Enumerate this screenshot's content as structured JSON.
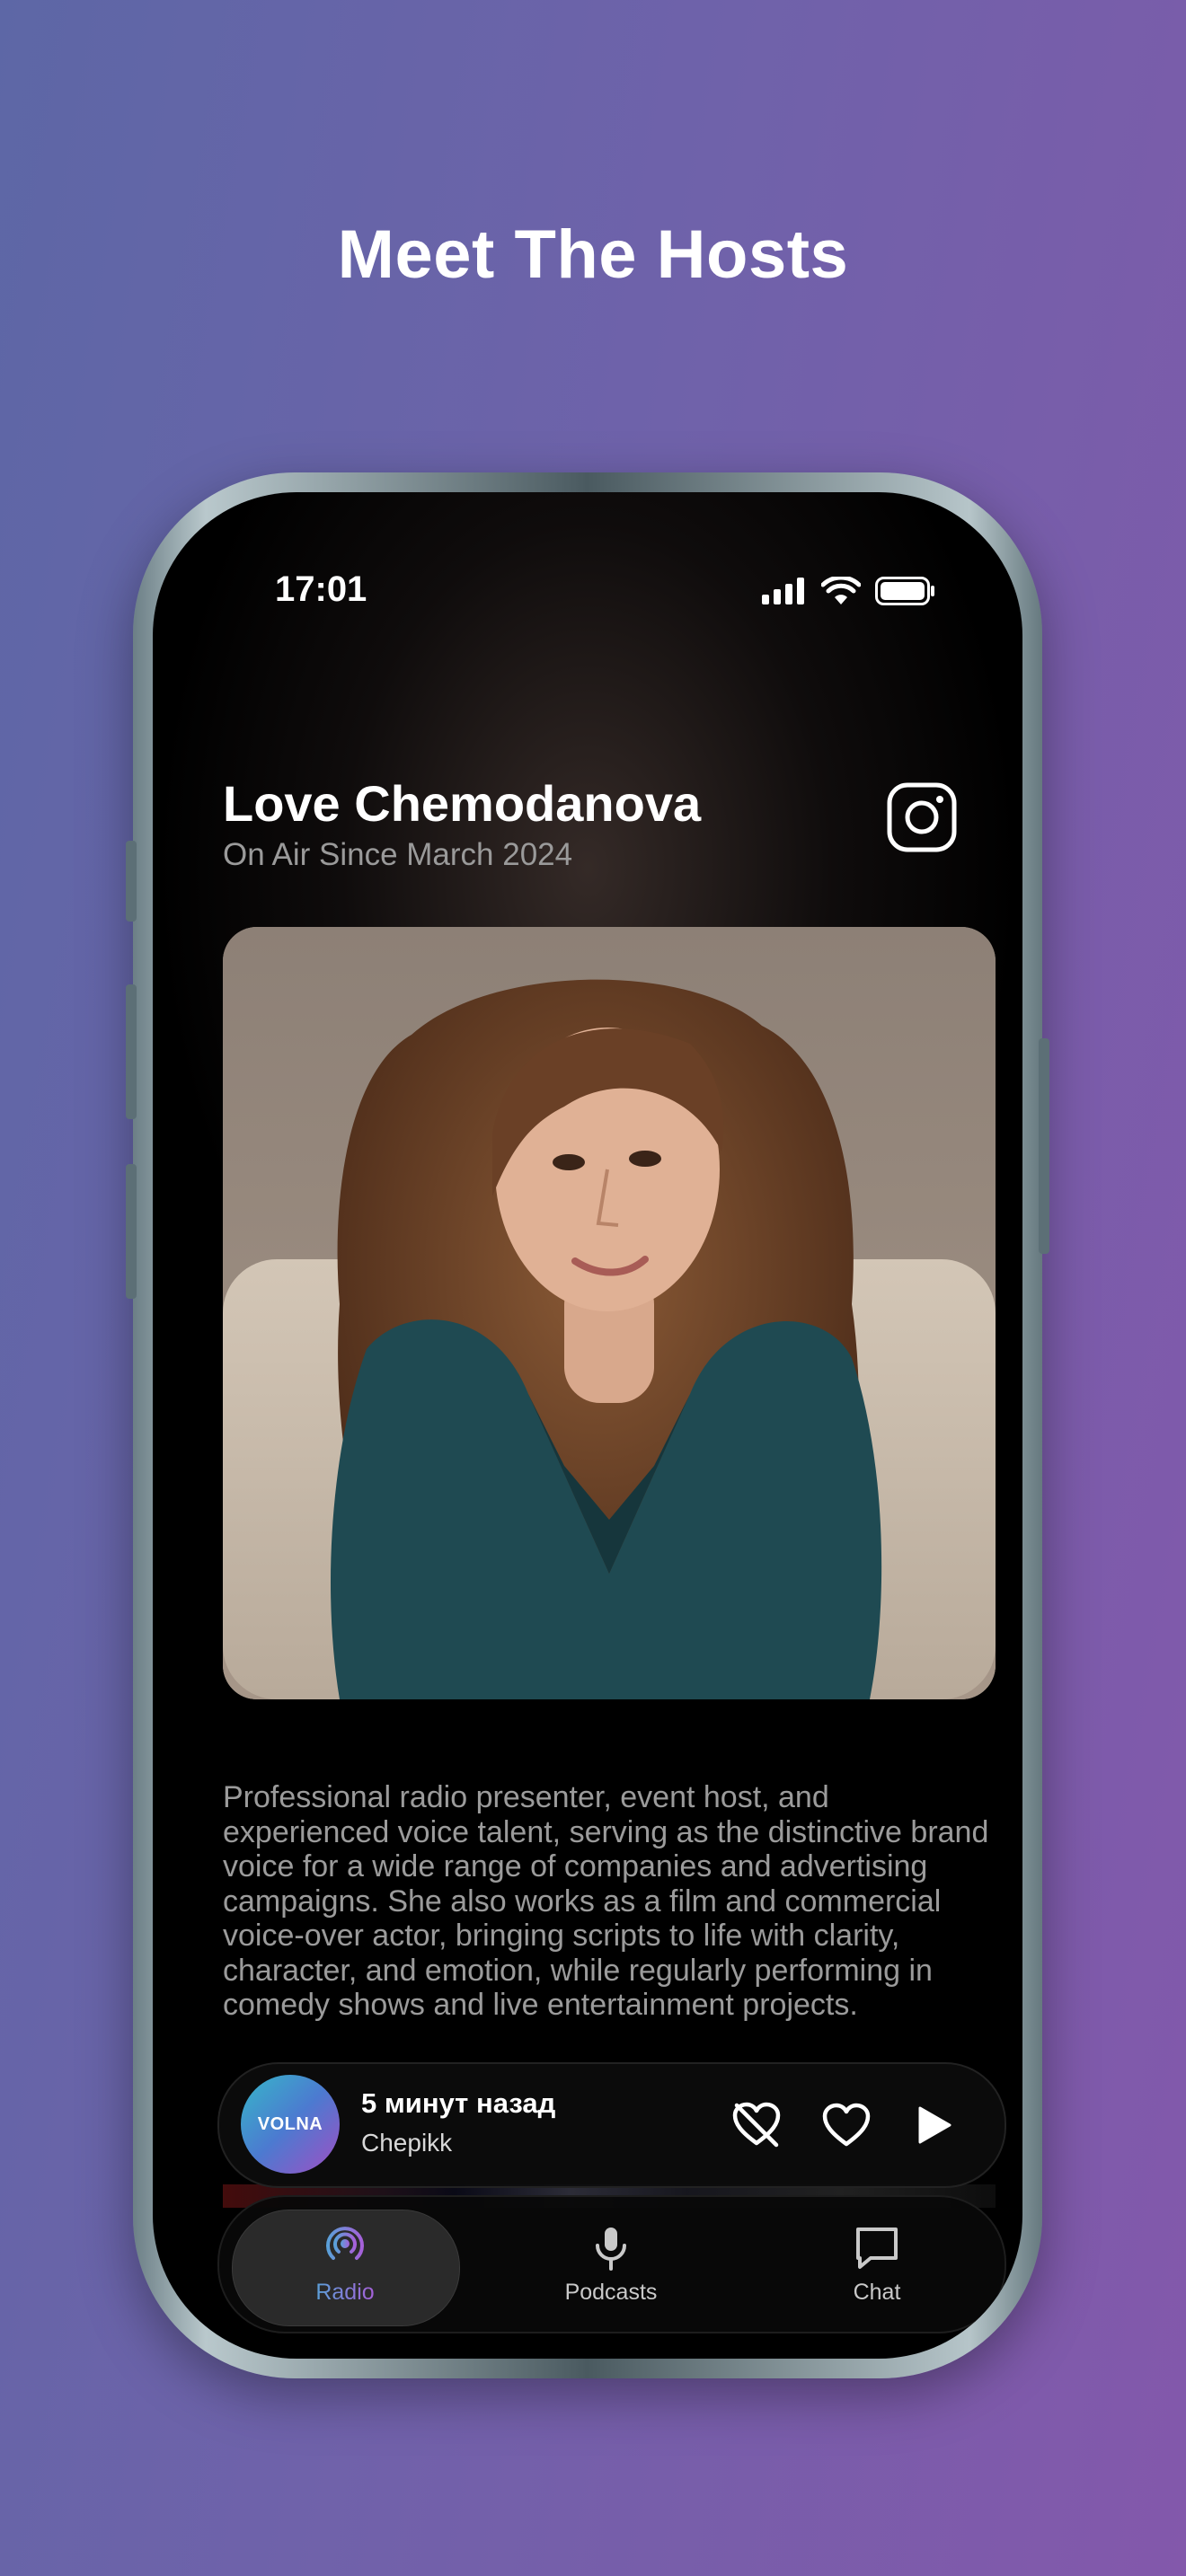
{
  "headline": "Meet The Hosts",
  "status_bar": {
    "time": "17:01",
    "icons": [
      "signal-icon",
      "wifi-icon",
      "battery-icon"
    ]
  },
  "host": {
    "name": "Love Chemodanova",
    "subtitle": "On Air Since March 2024",
    "bio": "Professional radio presenter, event host, and experienced voice talent, serving as the distinctive brand voice for a wide range of companies and advertising campaigns. She also works as a film and commercial voice-over actor, bringing scripts to life with clarity, character, and emotion, while regularly performing in comedy shows and live entertainment projects."
  },
  "player": {
    "station_logo": "VOLNA",
    "title": "5 минут назад",
    "artist": "Chepikk",
    "buttons": [
      "dislike-icon",
      "like-icon",
      "play-icon"
    ]
  },
  "tabs": [
    {
      "label": "Radio",
      "icon": "podcast-radio-icon",
      "active": true
    },
    {
      "label": "Podcasts",
      "icon": "microphone-icon",
      "active": false
    },
    {
      "label": "Chat",
      "icon": "chat-bubble-icon",
      "active": false
    }
  ],
  "colors": {
    "background_start": "#5d67a6",
    "background_end": "#8358ab",
    "accent_start": "#5aa0d8",
    "accent_end": "#a560d8"
  }
}
